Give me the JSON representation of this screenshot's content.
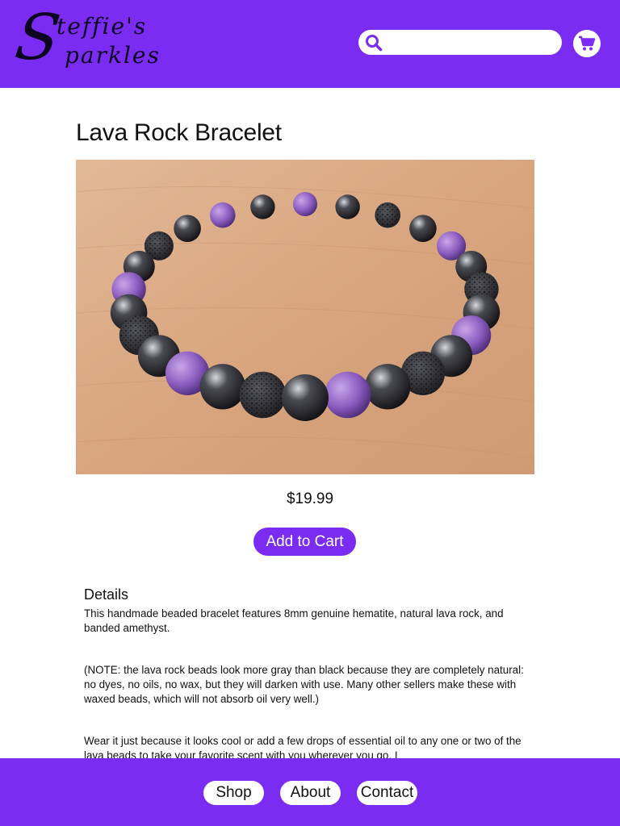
{
  "header": {
    "logo_line1": "teffie's",
    "logo_line2": "parkles",
    "logo_initial": "S",
    "search": {
      "placeholder": "",
      "value": ""
    },
    "icons": {
      "search": "search-icon",
      "cart": "cart-icon"
    }
  },
  "product": {
    "title": "Lava Rock Bracelet",
    "price": "$19.99",
    "add_to_cart_label": "Add to Cart"
  },
  "details": {
    "heading": "Details",
    "paragraphs": [
      "This handmade beaded bracelet features 8mm genuine hematite, natural lava rock, and banded amethyst.",
      "(NOTE: the lava rock beads look more gray than black because they are completely natural: no dyes, no oils, no wax, but they will darken with use.  Many other sellers make these with waxed beads, which will not absorb oil very well.)",
      " Wear it just because it looks cool or add a few drops of essential oil to any one or two of the lava beads to take your favorite scent with you wherever you go. I"
    ]
  },
  "footer": {
    "nav": [
      "Shop",
      "About",
      "Contact"
    ]
  },
  "colors": {
    "brand_purple": "#7b2cf2",
    "white": "#ffffff",
    "text": "#111111"
  }
}
